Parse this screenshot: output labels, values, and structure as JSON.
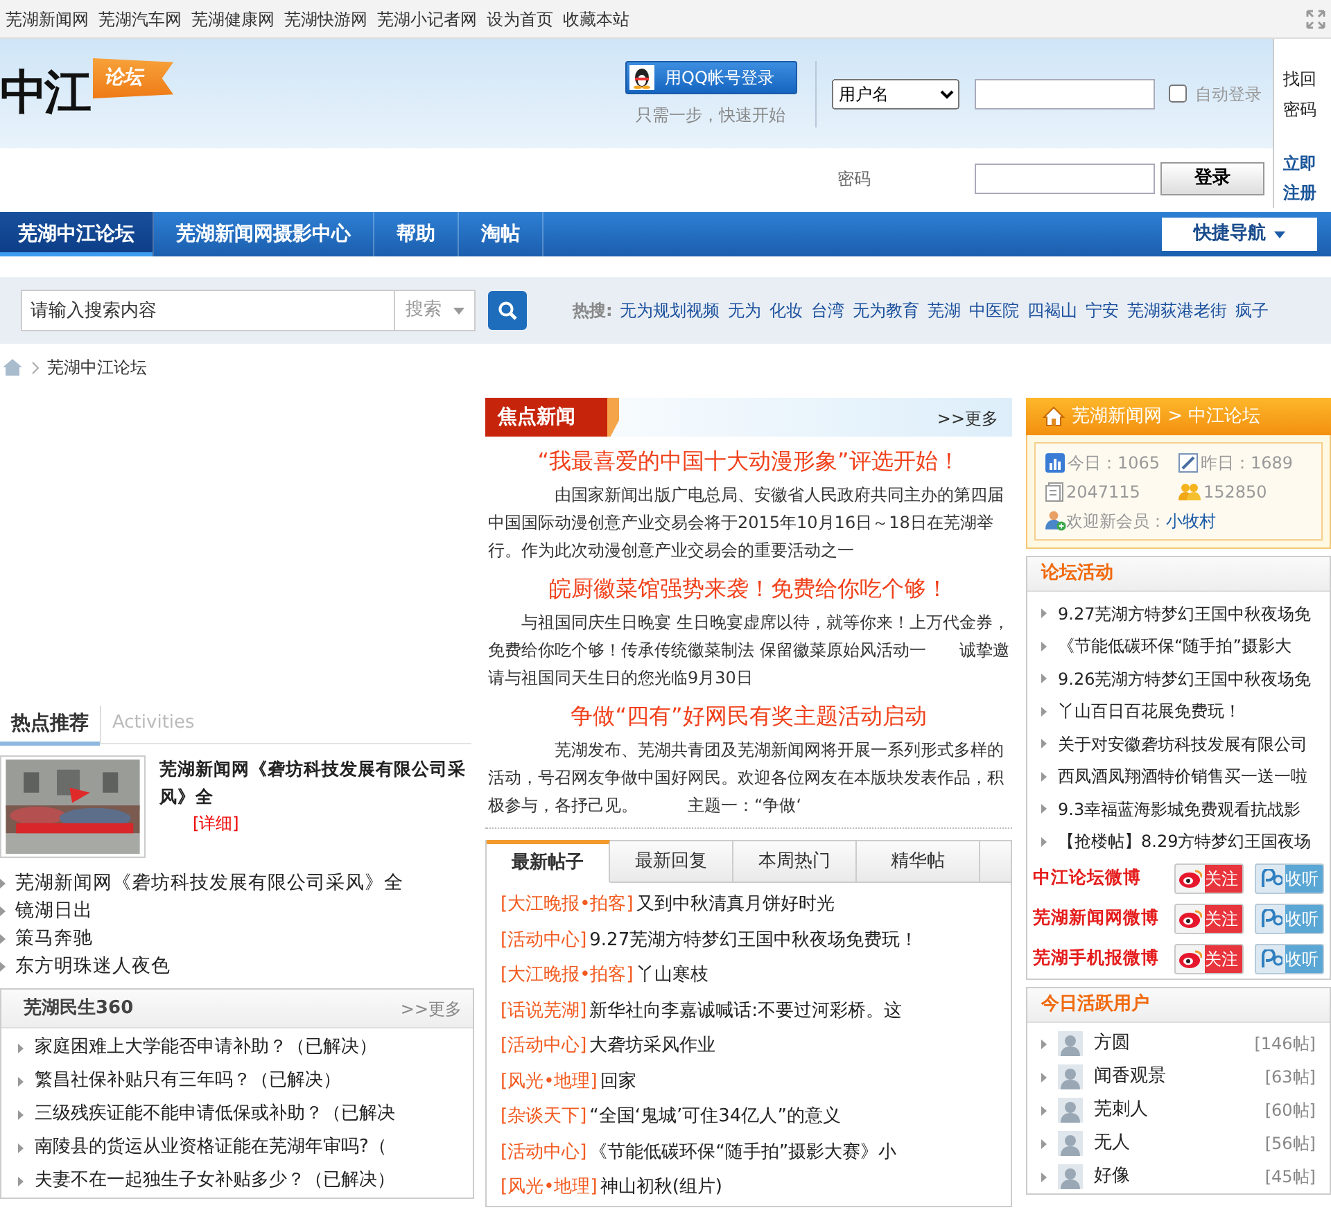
{
  "top_links": [
    "芜湖新闻网",
    "芜湖汽车网",
    "芜湖健康网",
    "芜湖快游网",
    "芜湖小记者网",
    "设为首页",
    "收藏本站"
  ],
  "logo": {
    "main": "中江",
    "tag": "论坛"
  },
  "qq_login": {
    "button": "用QQ帐号登录",
    "hint": "只需一步，快速开始"
  },
  "login": {
    "account_type": "用户名",
    "auto_login_label": "自动登录",
    "auto_login_checked": false,
    "password_label": "密码",
    "submit": "登录",
    "find_password": "找回密码",
    "register": "立即注册"
  },
  "nav": {
    "items": [
      {
        "label": "芜湖中江论坛",
        "selected": true
      },
      {
        "label": "芜湖新闻网摄影中心",
        "selected": false
      },
      {
        "label": "帮助",
        "selected": false
      },
      {
        "label": "淘帖",
        "selected": false
      }
    ],
    "quick_nav": "快捷导航"
  },
  "search": {
    "placeholder": "请输入搜索内容",
    "scope": "搜索",
    "hot_label": "热搜:",
    "hot_terms": [
      "无为规划视频",
      "无为",
      "化妆",
      "台湾",
      "无为教育",
      "芜湖",
      "中医院",
      "四褐山",
      "宁安",
      "芜湖荻港老街",
      "疯子"
    ]
  },
  "breadcrumb": [
    "芜湖中江论坛"
  ],
  "hot_recommend": {
    "tabs": [
      {
        "label": "热点推荐",
        "selected": true
      },
      {
        "label": "Activities",
        "selected": false
      }
    ],
    "feature": {
      "kind": "picture",
      "title": "芜湖新闻网《砻坊科技发展有限公司采风》全",
      "more": "[详细]"
    },
    "items": [
      "芜湖新闻网《砻坊科技发展有限公司采风》全",
      "镜湖日出",
      "策马奔驰",
      "东方明珠迷人夜色"
    ]
  },
  "livelihood": {
    "title": "芜湖民生360",
    "more": ">>更多",
    "items": [
      "家庭困难上大学能否申请补助？（已解决）",
      "繁昌社保补贴只有三年吗？（已解决）",
      "三级残疾证能不能申请低保或补助？（已解决",
      "南陵县的货运从业资格证能在芜湖年审吗?（",
      "夫妻不在一起独生子女补贴多少？（已解决）"
    ]
  },
  "focus_news": {
    "title": "焦点新闻",
    "more": ">>更多",
    "articles": [
      {
        "headline": "“我最喜爱的中国十大动漫形象”评选开始！",
        "body": "由国家新闻出版广电总局、安徽省人民政府共同主办的第四届中国国际动漫创意产业交易会将于2015年10月16日～18日在芜湖举行。作为此次动漫创意产业交易会的重要活动之一"
      },
      {
        "headline": "皖厨徽菜馆强势来袭！免费给你吃个够！",
        "body": "与祖国同庆生日晚宴 生日晚宴虚席以待，就等你来！上万代金券，免费给你吃个够！传承传统徽菜制法 保留徽菜原始风活动一　　诚挚邀请与祖国同天生日的您光临9月30日"
      },
      {
        "headline": "争做“四有”好网民有奖主题活动启动",
        "body": "芜湖发布、芜湖共青团及芜湖新闻网将开展一系列形式多样的活动，号召网友争做中国好网民。欢迎各位网友在本版块发表作品，积极参与，各抒己见。　　　主题一：“争做‘"
      }
    ]
  },
  "post_tabs": [
    {
      "label": "最新帖子",
      "selected": true
    },
    {
      "label": "最新回复",
      "selected": false
    },
    {
      "label": "本周热门",
      "selected": false
    },
    {
      "label": "精华帖",
      "selected": false
    }
  ],
  "posts": [
    {
      "category": "[大江晚报•拍客]",
      "title": "又到中秋清真月饼好时光"
    },
    {
      "category": "[活动中心]",
      "title": "9.27芜湖方特梦幻王国中秋夜场免费玩！"
    },
    {
      "category": "[大江晚报•拍客]",
      "title": "丫山寒枝"
    },
    {
      "category": "[话说芜湖]",
      "title": "新华社向李嘉诚喊话:不要过河彩桥。这"
    },
    {
      "category": "[活动中心]",
      "title": "大砻坊采风作业"
    },
    {
      "category": "[风光•地理]",
      "title": "回家"
    },
    {
      "category": "[杂谈天下]",
      "title": "“全国‘鬼城’可住34亿人”的意义"
    },
    {
      "category": "[活动中心]",
      "title": "《节能低碳环保“随手拍”摄影大赛》小"
    },
    {
      "category": "[风光•地理]",
      "title": "神山初秋(组片)"
    }
  ],
  "forum_stats": {
    "path": "芜湖新闻网 > 中江论坛",
    "today": "今日：1065",
    "yesterday": "昨日：1689",
    "posts": "2047115",
    "members": "152850",
    "welcome_label": "欢迎新会员：",
    "newest_member": "小牧村"
  },
  "activities": {
    "title": "论坛活动",
    "items": [
      "9.27芜湖方特梦幻王国中秋夜场免",
      "《节能低碳环保“随手拍”摄影大",
      "9.26芜湖方特梦幻王国中秋夜场免",
      "丫山百日百花展免费玩！",
      "关于对安徽砻坊科技发展有限公司",
      "西凤酒凤翔酒特价销售买一送一啦",
      "9.3幸福蓝海影城免费观看抗战影",
      "【抢楼帖】8.29方特梦幻王国夜场"
    ]
  },
  "weibo": [
    {
      "name": "中江论坛微博",
      "follow": "关注",
      "listen": "收听"
    },
    {
      "name": "芜湖新闻网微博",
      "follow": "关注",
      "listen": "收听"
    },
    {
      "name": "芜湖手机报微博",
      "follow": "关注",
      "listen": "收听"
    }
  ],
  "active_users": {
    "title": "今日活跃用户",
    "users": [
      {
        "name": "方圆",
        "count": "[146帖]"
      },
      {
        "name": "闻香观景",
        "count": "[63帖]"
      },
      {
        "name": "芜刺人",
        "count": "[60帖]"
      },
      {
        "name": "无人",
        "count": "[56帖]"
      },
      {
        "name": "好像",
        "count": "[45帖]"
      }
    ]
  }
}
